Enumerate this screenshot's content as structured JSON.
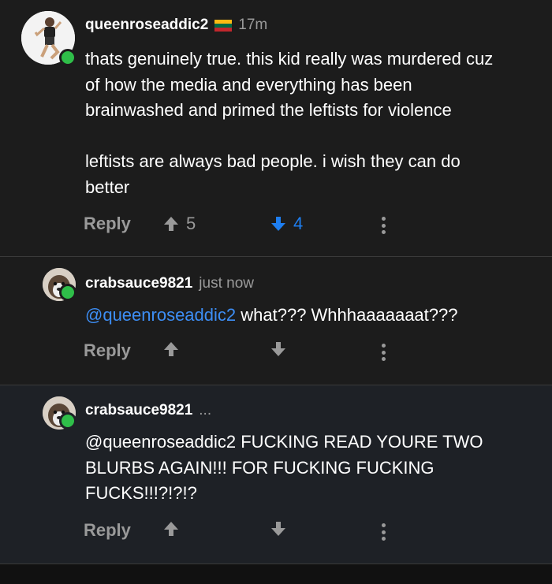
{
  "comments": [
    {
      "username": "queenroseaddic2",
      "time": "17m",
      "text": "thats genuinely true. this kid really was murdered cuz\nof how the media and everything has been\nbrainwashed and primed the leftists for violence\n\nleftists are always bad people. i wish they can do\nbetter",
      "reply_label": "Reply",
      "upvotes": "5",
      "downvotes": "4",
      "downvote_active": true
    },
    {
      "username": "crabsauce9821",
      "time": "just now",
      "mention": "@queenroseaddic2",
      "text": " what??? Whhhaaaaaaat???",
      "reply_label": "Reply",
      "upvotes": "",
      "downvotes": ""
    },
    {
      "username": "crabsauce9821",
      "time": "...",
      "text": "@queenroseaddic2 FUCKING READ YOURE TWO\nBLURBS AGAIN!!! FOR FUCKING FUCKING\nFUCKS!!!?!?!?",
      "reply_label": "Reply",
      "upvotes": "",
      "downvotes": ""
    }
  ],
  "icons": {
    "flag": "lithuania-flag-icon",
    "upvote": "arrow-up-icon",
    "downvote": "arrow-down-icon",
    "more": "more-vertical-icon"
  },
  "colors": {
    "online": "#2fbe49",
    "mention": "#3d8ef5",
    "downvote_active": "#1e7ef0"
  }
}
